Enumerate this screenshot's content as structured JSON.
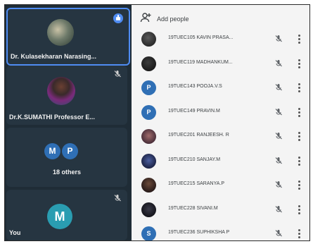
{
  "tiles": [
    {
      "name": "Dr. Kulasekharan Narasing...",
      "state": "speaking"
    },
    {
      "name": "Dr.K.SUMATHI Professor E...",
      "state": "muted"
    },
    {
      "others": {
        "initials": [
          "M",
          "P"
        ],
        "label": "18 others"
      }
    },
    {
      "name": "You",
      "initial": "M",
      "state": "muted"
    }
  ],
  "panel": {
    "add_people_label": "Add people",
    "participants": [
      {
        "name": "19TUEC105 KAVIN PRASA...",
        "avatar": "photo"
      },
      {
        "name": "19TUEC119 MADHANKUM...",
        "avatar": "photo"
      },
      {
        "name": "19TUEC143 POOJA.V.S",
        "avatar": "P"
      },
      {
        "name": "19TUEC149 PRAVIN.M",
        "avatar": "P"
      },
      {
        "name": "19TUEC201 RANJEESH. R",
        "avatar": "photo"
      },
      {
        "name": "19TUEC210 SANJAY.M",
        "avatar": "photo"
      },
      {
        "name": "19TUEC215 SARANYA.P",
        "avatar": "photo"
      },
      {
        "name": "19TUEC228 SIVANI.M",
        "avatar": "photo"
      },
      {
        "name": "19TUEC236 SUPHIKSHA P",
        "avatar": "S"
      }
    ]
  },
  "colors": {
    "accent": "#4f8cf2",
    "avatar_blue": "#2f6fb5",
    "avatar_teal": "#2a9db1"
  }
}
